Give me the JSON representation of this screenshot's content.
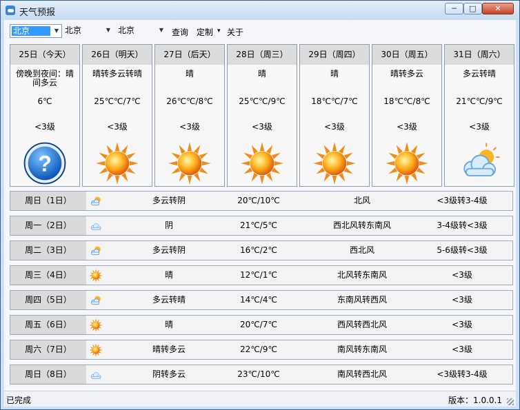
{
  "window": {
    "title": "天气预报",
    "min_label": "─",
    "max_label": "□",
    "close_label": "✕"
  },
  "toolbar": {
    "province": "北京",
    "city": "北京",
    "district": "北京",
    "query_label": "查询",
    "custom_label": "定制",
    "custom_arrow": "▾",
    "about_label": "关于"
  },
  "forecast_cards": [
    {
      "date": "25日（今天）",
      "condition": "傍晚到夜间：晴间多云",
      "temp": "6℃",
      "wind": "<3级",
      "icon": "question-icon"
    },
    {
      "date": "26日（明天）",
      "condition": "晴转多云转晴",
      "temp": "25℃℃/7℃",
      "wind": "<3级",
      "icon": "sun-icon"
    },
    {
      "date": "27日（后天）",
      "condition": "晴",
      "temp": "26℃℃/8℃",
      "wind": "<3级",
      "icon": "sun-icon"
    },
    {
      "date": "28日（周三）",
      "condition": "晴",
      "temp": "25℃℃/9℃",
      "wind": "<3级",
      "icon": "sun-icon"
    },
    {
      "date": "29日（周四）",
      "condition": "晴",
      "temp": "18℃℃/7℃",
      "wind": "<3级",
      "icon": "sun-icon"
    },
    {
      "date": "30日（周五）",
      "condition": "晴转多云",
      "temp": "18℃℃/8℃",
      "wind": "<3级",
      "icon": "sun-icon"
    },
    {
      "date": "31日（周六）",
      "condition": "多云转晴",
      "temp": "21℃℃/9℃",
      "wind": "<3级",
      "icon": "sun-behind-cloud-icon"
    }
  ],
  "weekly_rows": [
    {
      "day": "周日（1日）",
      "icon": "partly-cloudy-icon",
      "condition": "多云转阴",
      "temp": "20℃/10℃",
      "wind_dir": "北风",
      "wind_level": "<3级转3-4级"
    },
    {
      "day": "周一（2日）",
      "icon": "cloud-icon",
      "condition": "阴",
      "temp": "21℃/5℃",
      "wind_dir": "西北风转东南风",
      "wind_level": "3-4级转<3级"
    },
    {
      "day": "周二（3日）",
      "icon": "partly-cloudy-icon",
      "condition": "多云转阴",
      "temp": "16℃/2℃",
      "wind_dir": "西北风",
      "wind_level": "5-6级转<3级"
    },
    {
      "day": "周三（4日）",
      "icon": "sun-icon",
      "condition": "晴",
      "temp": "12℃/1℃",
      "wind_dir": "北风转东南风",
      "wind_level": "<3级"
    },
    {
      "day": "周四（5日）",
      "icon": "partly-cloudy-icon",
      "condition": "多云转晴",
      "temp": "14℃/4℃",
      "wind_dir": "东南风转西风",
      "wind_level": "<3级"
    },
    {
      "day": "周五（6日）",
      "icon": "sun-icon",
      "condition": "晴",
      "temp": "20℃/7℃",
      "wind_dir": "西风转西北风",
      "wind_level": "<3级"
    },
    {
      "day": "周六（7日）",
      "icon": "sun-icon",
      "condition": "晴转多云",
      "temp": "22℃/9℃",
      "wind_dir": "南风转东南风",
      "wind_level": "<3级"
    },
    {
      "day": "周日（8日）",
      "icon": "cloud-icon",
      "condition": "阴转多云",
      "temp": "23℃/10℃",
      "wind_dir": "南风转西北风",
      "wind_level": "<3级转3-4级"
    }
  ],
  "status": {
    "text": "已完成",
    "version": "版本：1.0.0.1"
  }
}
